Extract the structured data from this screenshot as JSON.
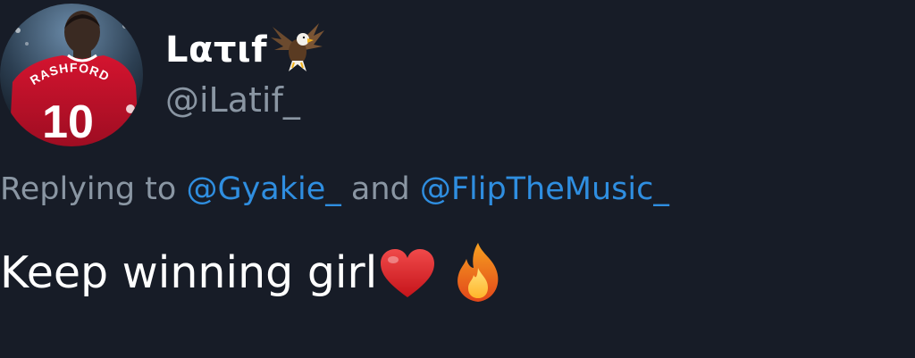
{
  "tweet": {
    "display_name": "Lατιf",
    "handle": "@iLatif_",
    "reply": {
      "prefix": "Replying to ",
      "mention1": "@Gyakie_",
      "conjunction": " and ",
      "mention2": "@FlipTheMusic_"
    },
    "text": "Keep winning girl",
    "emojis": [
      "heart-icon",
      "fire-icon"
    ],
    "name_emoji": "eagle-icon"
  },
  "avatar": {
    "jersey_name": "RASHFORD",
    "jersey_number": "10"
  },
  "colors": {
    "background": "#171c27",
    "text": "#ffffff",
    "secondary": "#8a96a3",
    "link": "#2f8ee0",
    "jersey": "#c8102e"
  }
}
